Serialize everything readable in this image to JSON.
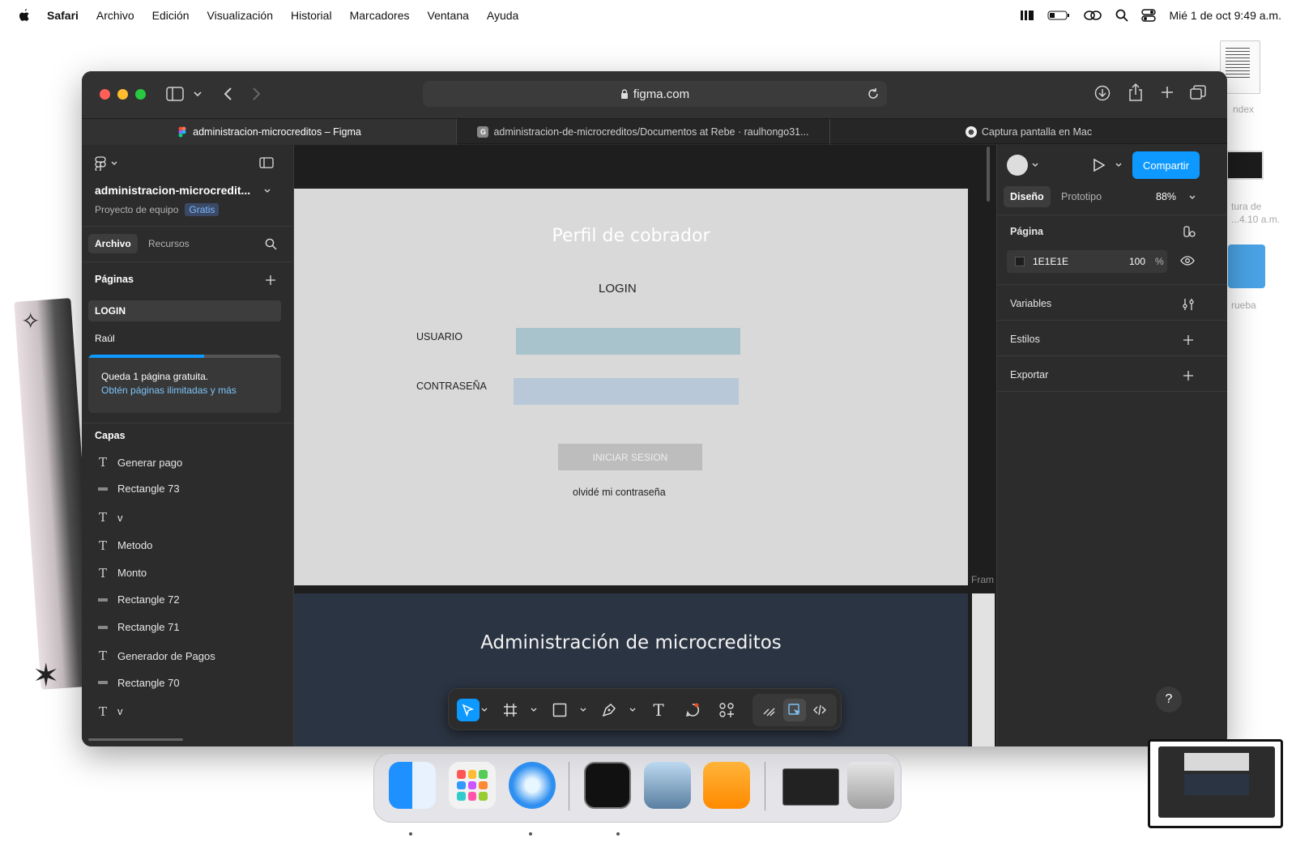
{
  "menubar": {
    "app": "Safari",
    "items": [
      "Archivo",
      "Edición",
      "Visualización",
      "Historial",
      "Marcadores",
      "Ventana",
      "Ayuda"
    ],
    "clock": "Mié 1 de oct  9:49 a.m."
  },
  "desktop": {
    "file_label": "ndex",
    "shot_label_1": "tura de",
    "shot_label_2": "...4.10 a.m.",
    "folder_label": "rueba"
  },
  "browser": {
    "url": "figma.com",
    "tabs": [
      {
        "label": "administracion-microcreditos – Figma",
        "active": true
      },
      {
        "label": "administracion-de-microcreditos/Documentos at Rebe · raulhongo31...",
        "active": false
      },
      {
        "label": "Captura pantalla en Mac",
        "active": false
      }
    ]
  },
  "figma": {
    "file_name": "administracion-microcredit...",
    "project": "Proyecto de equipo",
    "plan_badge": "Gratis",
    "left_tabs": [
      "Archivo",
      "Recursos"
    ],
    "pages_heading": "Páginas",
    "pages": [
      "LOGIN",
      "Raúl"
    ],
    "upsell_text": "Queda 1 página gratuita.",
    "upsell_link": "Obtén páginas ilimitadas y más",
    "upsell_progress": 0.6,
    "layers_heading": "Capas",
    "layers": [
      {
        "type": "text",
        "name": "Generar pago"
      },
      {
        "type": "rect",
        "name": "Rectangle 73"
      },
      {
        "type": "text",
        "name": "v"
      },
      {
        "type": "text",
        "name": "Metodo"
      },
      {
        "type": "text",
        "name": "Monto"
      },
      {
        "type": "rect",
        "name": "Rectangle 72"
      },
      {
        "type": "rect",
        "name": "Rectangle 71"
      },
      {
        "type": "text",
        "name": "Generador de Pagos"
      },
      {
        "type": "rect",
        "name": "Rectangle 70"
      },
      {
        "type": "text",
        "name": "v"
      }
    ],
    "canvas": {
      "frame1_title": "Perfil de cobrador",
      "frame1_subtitle": "LOGIN",
      "user_label": "USUARIO",
      "password_label": "CONTRASEÑA",
      "login_button": "INICIAR SESION",
      "forgot": "olvidé mi contraseña",
      "frame2_title": "Administración de microcreditos",
      "side_label": "Fram"
    },
    "right": {
      "share": "Compartir",
      "tab_design": "Diseño",
      "tab_prototype": "Prototipo",
      "zoom": "88%",
      "page_heading": "Página",
      "bg_color": "1E1E1E",
      "bg_opacity": "100",
      "percent": "%",
      "variables": "Variables",
      "styles": "Estilos",
      "export": "Exportar",
      "help": "?"
    }
  },
  "colors": {
    "accent": "#0d99ff",
    "canvas_bg": "#1e1e1e",
    "input1": "#a8c3cb",
    "input2": "#b8c8d8"
  }
}
